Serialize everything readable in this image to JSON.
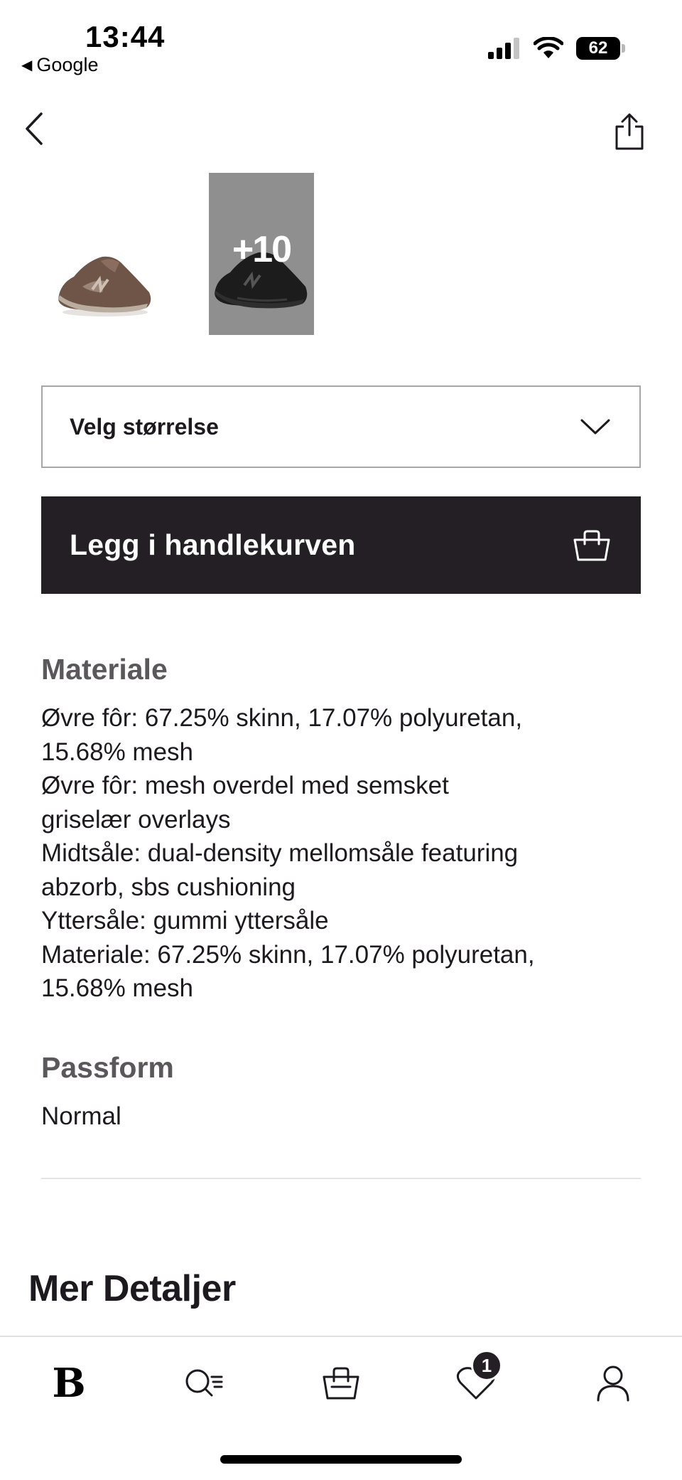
{
  "status_bar": {
    "time": "13:44",
    "back_app": "Google",
    "battery": "62",
    "icons": [
      "signal-icon",
      "wifi-icon",
      "battery-icon"
    ]
  },
  "nav": {
    "icons": [
      "chevron-left-icon",
      "share-icon"
    ]
  },
  "gallery": {
    "more_count": "+10"
  },
  "size_select": {
    "label": "Velg størrelse"
  },
  "cart_button": {
    "label": "Legg i handlekurven"
  },
  "material": {
    "title": "Materiale",
    "lines": [
      "Øvre fôr: 67.25% skinn, 17.07% polyuretan,",
      "15.68% mesh",
      "Øvre fôr: mesh overdel med semsket",
      "griselær overlays",
      "Midtsåle: dual-density mellomsåle featuring",
      "abzorb, sbs cushioning",
      "Yttersåle: gummi yttersåle",
      "Materiale: 67.25% skinn, 17.07% polyuretan,",
      "15.68% mesh"
    ]
  },
  "fit": {
    "title": "Passform",
    "value": "Normal"
  },
  "more_details": {
    "title": "Mer Detaljer"
  },
  "tabbar": {
    "logo": "B",
    "wishlist_badge": "1",
    "icons": [
      "home-logo",
      "search-icon",
      "bag-icon",
      "heart-icon",
      "profile-icon"
    ]
  },
  "colors": {
    "dark": "#231f24",
    "muted_heading": "#5b585c",
    "border": "#a7a5a8"
  }
}
